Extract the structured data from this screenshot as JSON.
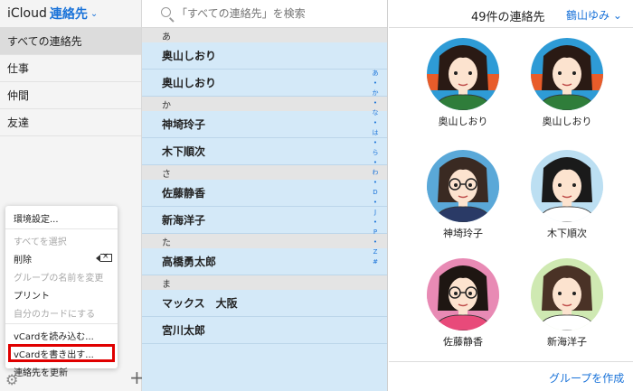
{
  "app": {
    "brand": "iCloud",
    "section": "連絡先"
  },
  "groups": [
    "すべての連絡先",
    "仕事",
    "仲間",
    "友達"
  ],
  "menu": {
    "items": [
      {
        "label": "環境設定...",
        "disabled": false
      },
      {
        "label": "すべてを選択",
        "disabled": true
      },
      {
        "label": "削除",
        "disabled": false
      },
      {
        "label": "グループの名前を変更",
        "disabled": true
      },
      {
        "label": "プリント",
        "disabled": false
      },
      {
        "label": "自分のカードにする",
        "disabled": true
      },
      {
        "label": "vCardを読み込む...",
        "disabled": false
      },
      {
        "label": "vCardを書き出す...",
        "disabled": false
      },
      {
        "label": "連絡先を更新",
        "disabled": false
      }
    ]
  },
  "search": {
    "placeholder": "「すべての連絡先」を検索"
  },
  "list": [
    {
      "header": "あ",
      "names": [
        "奥山しおり",
        "奥山しおり"
      ]
    },
    {
      "header": "か",
      "names": [
        "神埼玲子",
        "木下順次"
      ]
    },
    {
      "header": "さ",
      "names": [
        "佐藤静香",
        "新海洋子"
      ]
    },
    {
      "header": "た",
      "names": [
        "高橋勇太郎"
      ]
    },
    {
      "header": "ま",
      "names": [
        "マックス　大阪",
        "宮川太郎"
      ]
    }
  ],
  "index": [
    "あ",
    "•",
    "か",
    "•",
    "な",
    "•",
    "は",
    "•",
    "ら",
    "•",
    "わ",
    "•",
    "D",
    "•",
    "J",
    "•",
    "P",
    "•",
    "Z",
    "#"
  ],
  "right": {
    "count": "49件の連絡先",
    "account": "鶴山ゆみ",
    "create_group": "グループを作成",
    "cards": [
      {
        "name": "奥山しおり",
        "bg": "#e85c2a",
        "bg2": "#2e9bd6",
        "hair": "#2a1a14",
        "shirt": "#2f7d3a",
        "glasses": false
      },
      {
        "name": "奥山しおり",
        "bg": "#e85c2a",
        "bg2": "#2e9bd6",
        "hair": "#2a1a14",
        "shirt": "#2f7d3a",
        "glasses": false
      },
      {
        "name": "神埼玲子",
        "bg": "#5aa8d8",
        "bg2": "#5aa8d8",
        "hair": "#3a2a22",
        "shirt": "#2a3a66",
        "glasses": true
      },
      {
        "name": "木下順次",
        "bg": "#bcdff2",
        "bg2": "#bcdff2",
        "hair": "#1a1a1a",
        "shirt": "#ffffff",
        "glasses": false
      },
      {
        "name": "佐藤静香",
        "bg": "#e88ab4",
        "bg2": "#e88ab4",
        "hair": "#1e1612",
        "shirt": "#e84a7a",
        "glasses": true
      },
      {
        "name": "新海洋子",
        "bg": "#cfe9b2",
        "bg2": "#cfe9b2",
        "hair": "#4a3226",
        "shirt": "#ffffff",
        "glasses": false
      }
    ]
  }
}
